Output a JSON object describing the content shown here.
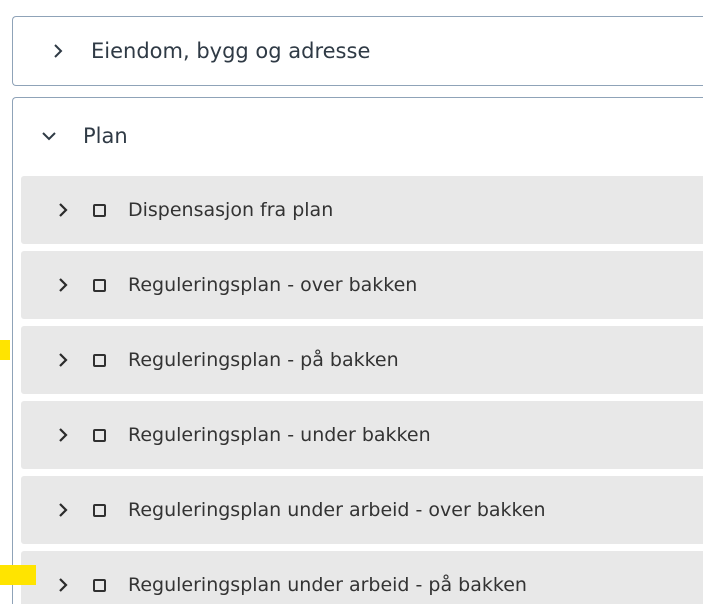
{
  "sections": {
    "eiendom": {
      "title": "Eiendom, bygg og adresse",
      "expanded": false
    },
    "plan": {
      "title": "Plan",
      "expanded": true,
      "items": [
        {
          "label": "Dispensasjon fra plan",
          "checked": false,
          "highlighted": false
        },
        {
          "label": "Reguleringsplan - over bakken",
          "checked": false,
          "highlighted": false
        },
        {
          "label": "Reguleringsplan - på bakken",
          "checked": false,
          "highlighted": true
        },
        {
          "label": "Reguleringsplan - under bakken",
          "checked": false,
          "highlighted": false
        },
        {
          "label": "Reguleringsplan under arbeid - over bakken",
          "checked": false,
          "highlighted": false
        },
        {
          "label": "Reguleringsplan under arbeid - på bakken",
          "checked": false,
          "highlighted": true
        }
      ]
    }
  },
  "colors": {
    "border": "#8fa3b8",
    "row_background": "#e8e8e8",
    "highlight_marker": "#ffe400",
    "text": "#2f3a45"
  },
  "icons": {
    "collapsed": "chevron-right-icon",
    "expanded": "chevron-down-icon",
    "checkbox": "checkbox-unchecked-icon"
  }
}
